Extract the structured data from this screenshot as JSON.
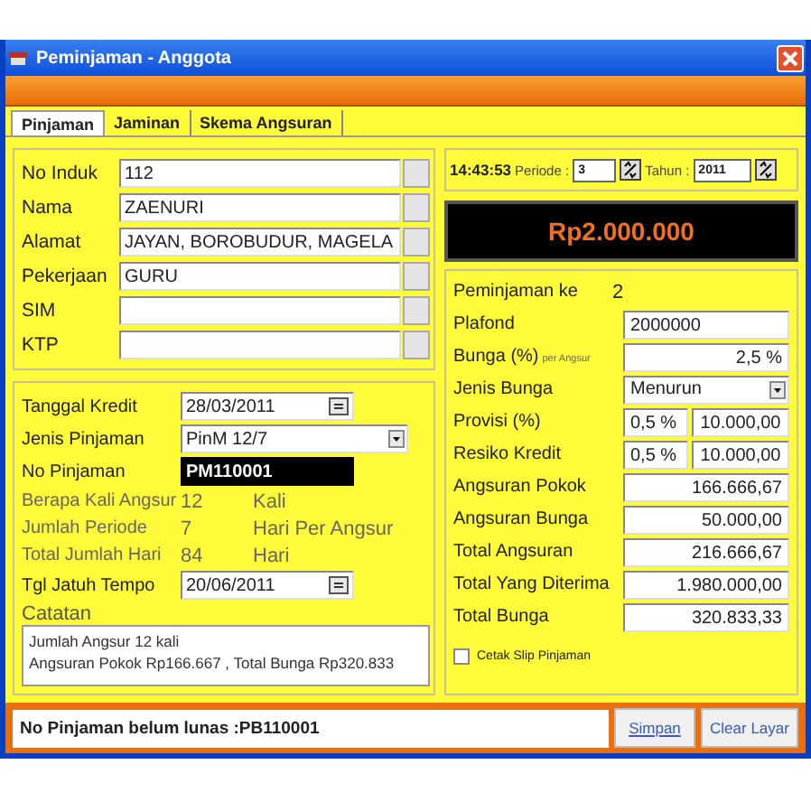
{
  "window": {
    "title": "Peminjaman - Anggota"
  },
  "tabs": [
    {
      "label": "Pinjaman",
      "selected": true
    },
    {
      "label": "Jaminan",
      "selected": false
    },
    {
      "label": "Skema Angsuran",
      "selected": false
    }
  ],
  "member_fields": [
    {
      "label": "No Induk",
      "value": "112"
    },
    {
      "label": "Nama",
      "value": "ZAENURI"
    },
    {
      "label": "Alamat",
      "value": "JAYAN, BOROBUDUR, MAGELA"
    },
    {
      "label": "Pekerjaan",
      "value": "GURU"
    },
    {
      "label": "SIM"
    },
    {
      "label": "KTP"
    }
  ],
  "loan": {
    "tanggal_kredit": {
      "label": "Tanggal Kredit",
      "value": "28/03/2011"
    },
    "jenis_pinjaman": {
      "label": "Jenis Pinjaman",
      "value": "PinM 12/7"
    },
    "no_pinjaman": {
      "label": "No Pinjaman",
      "value": "PM110001"
    },
    "info_rows": [
      {
        "label": "Berapa Kali Angsur",
        "value": "12",
        "unit": "Kali"
      },
      {
        "label": "Jumlah Periode",
        "value": "7",
        "unit": "Hari Per Angsur"
      },
      {
        "label": "Total Jumlah Hari",
        "value": "84",
        "unit": "Hari"
      }
    ],
    "tgl_jatuh_tempo": {
      "label": "Tgl Jatuh Tempo",
      "value": "20/06/2011"
    },
    "catatan": {
      "label": "Catatan",
      "lines": [
        "Jumlah Angsur 12 kali",
        "Angsuran Pokok Rp166.667 , Total Bunga Rp320.833"
      ]
    }
  },
  "header": {
    "time": "14:43:53",
    "periode_label": "Periode :",
    "periode": "3",
    "tahun_label": "Tahun :",
    "tahun": "2011"
  },
  "amount": "Rp2.000.000",
  "peminjaman_ke": {
    "label": "Peminjaman ke",
    "value": "2"
  },
  "calc_rows": [
    {
      "kind": "input",
      "label": "Plafond",
      "value": "2000000"
    },
    {
      "kind": "note",
      "label": "Bunga (%)",
      "note": "per Angsur",
      "value": "2,5 %"
    },
    {
      "kind": "select",
      "label": "Jenis Bunga",
      "value": "Menurun"
    },
    {
      "kind": "pair",
      "label": "Provisi (%)",
      "value": "0,5 %",
      "value_2": "10.000,00"
    },
    {
      "kind": "pair",
      "label": "Resiko Kredit",
      "value": "0,5 %",
      "value_2": "10.000,00"
    },
    {
      "kind": "amount",
      "label": "Angsuran Pokok",
      "value": "166.666,67"
    },
    {
      "kind": "amount",
      "label": "Angsuran Bunga",
      "value": "50.000,00"
    },
    {
      "kind": "amount",
      "label": "Total Angsuran",
      "value": "216.666,67"
    },
    {
      "kind": "amount",
      "label": "Total Yang Diterima",
      "value": "1.980.000,00"
    },
    {
      "kind": "amount",
      "label": "Total Bunga",
      "value": "320.833,33"
    }
  ],
  "print_slip": {
    "label": "Cetak Slip Pinjaman",
    "checked": false
  },
  "status": "No Pinjaman belum lunas :PB110001",
  "buttons": [
    "Simpan",
    "Clear Layar"
  ]
}
